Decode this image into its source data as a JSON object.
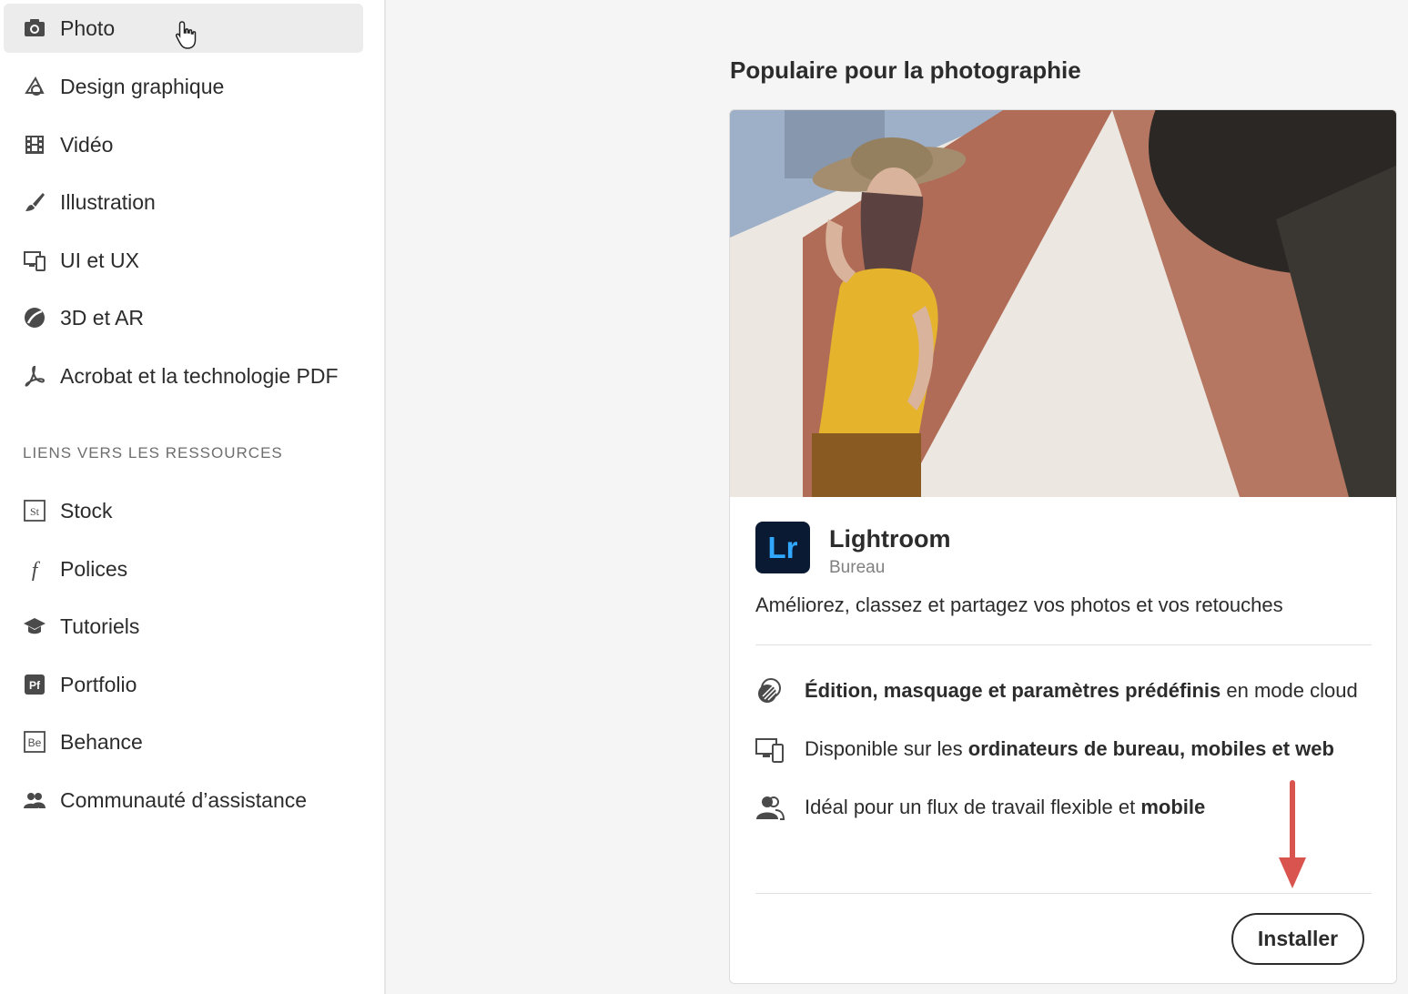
{
  "sidebar": {
    "items": [
      {
        "label": "Photo",
        "icon": "camera-icon"
      },
      {
        "label": "Design graphique",
        "icon": "design-icon"
      },
      {
        "label": "Vidéo",
        "icon": "film-icon"
      },
      {
        "label": "Illustration",
        "icon": "brush-icon"
      },
      {
        "label": "UI et UX",
        "icon": "devices-icon"
      },
      {
        "label": "3D et AR",
        "icon": "3d-icon"
      },
      {
        "label": "Acrobat et la technologie PDF",
        "icon": "acrobat-icon"
      }
    ],
    "resources_title": "LIENS VERS LES RESSOURCES",
    "resources": [
      {
        "label": "Stock",
        "icon": "stock-icon",
        "badge": "St"
      },
      {
        "label": "Polices",
        "icon": "fonts-icon",
        "badge": "f"
      },
      {
        "label": "Tutoriels",
        "icon": "graduation-cap-icon"
      },
      {
        "label": "Portfolio",
        "icon": "portfolio-icon",
        "badge": "Pf"
      },
      {
        "label": "Behance",
        "icon": "behance-icon",
        "badge": "Be"
      },
      {
        "label": "Communauté d’assistance",
        "icon": "community-icon"
      }
    ],
    "active_item": "Photo"
  },
  "main": {
    "heading": "Populaire pour la photographie",
    "card": {
      "app_icon_text": "Lr",
      "app_name": "Lightroom",
      "app_type": "Bureau",
      "description": "Améliorez, classez et partagez vos photos et vos retouches",
      "features": [
        {
          "icon": "cloud-edit-icon",
          "bold": "Édition, masquage et paramètres prédéfinis",
          "rest": " en mode cloud",
          "bold_first": true
        },
        {
          "icon": "devices-icon",
          "plain": "Disponible sur les ",
          "bold": "ordinateurs de bureau, mobiles et web",
          "bold_first": false
        },
        {
          "icon": "users-icon",
          "plain": "Idéal pour un flux de travail flexible et ",
          "bold": "mobile",
          "bold_first": false
        }
      ],
      "install_label": "Installer"
    }
  },
  "colors": {
    "lightroom_bg": "#0b1a33",
    "lightroom_fg": "#31a8ff",
    "annotation_arrow": "#d9534f",
    "active_nav_bg": "#ececec"
  }
}
